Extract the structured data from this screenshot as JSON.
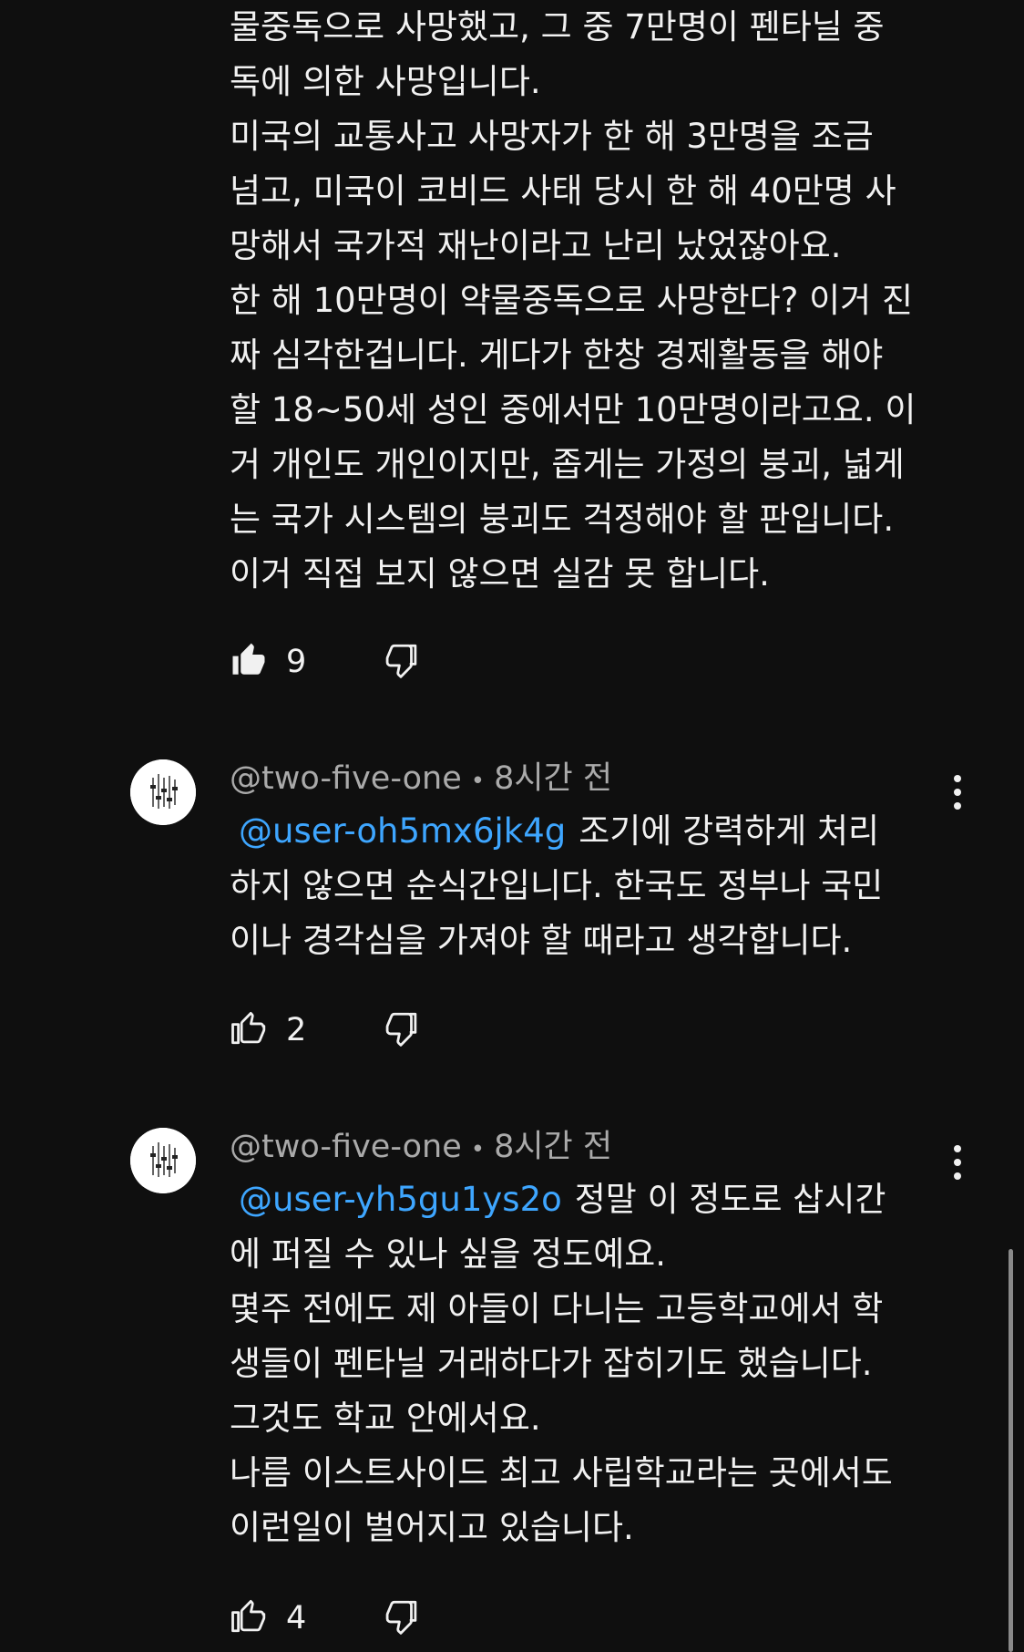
{
  "top_comment": {
    "lines": [
      "물중독으로 사망했고, 그 중 7만명이 펜타닐 중",
      "독에 의한 사망입니다.",
      "미국의 교통사고 사망자가 한 해 3만명을 조금",
      "넘고, 미국이 코비드 사태 당시 한 해 40만명 사",
      "망해서 국가적 재난이라고 난리 났었잖아요.",
      "한 해 10만명이 약물중독으로 사망한다? 이거 진",
      "짜 심각한겁니다. 게다가 한창 경제활동을 해야",
      "할 18~50세 성인 중에서만 10만명이라고요. 이",
      "거 개인도 개인이지만, 좁게는 가정의 붕괴, 넓게",
      "는 국가 시스템의 붕괴도 걱정해야 할 판입니다.",
      "이거 직접 보지 않으면 실감 못 합니다."
    ],
    "like_count": "9",
    "liked": true
  },
  "replies": [
    {
      "author": "@two-five-one",
      "separator": "•",
      "time": "8시간 전",
      "mention": "@user-oh5mx6jk4g",
      "first_line_rest": "조기에 강력하게 처리",
      "lines": [
        "하지 않으면 순식간입니다. 한국도 정부나 국민",
        "이나 경각심을 가져야 할 때라고 생각합니다."
      ],
      "like_count": "2",
      "liked": false
    },
    {
      "author": "@two-five-one",
      "separator": "•",
      "time": "8시간 전",
      "mention": "@user-yh5gu1ys2o",
      "first_line_rest": "정말 이 정도로 삽시간",
      "lines": [
        "에 퍼질 수 있나 싶을 정도예요.",
        "몇주 전에도 제 아들이 다니는 고등학교에서 학",
        "생들이 펜타닐 거래하다가 잡히기도 했습니다.",
        "그것도 학교 안에서요.",
        "나름 이스트사이드 최고 사립학교라는 곳에서도",
        "이런일이 벌어지고 있습니다."
      ],
      "like_count": "4",
      "liked": false
    }
  ],
  "colors": {
    "background": "#0f0f0f",
    "text": "#f1f1f1",
    "secondary_text": "#aaaaaa",
    "mention": "#3ea6ff"
  },
  "icons": {
    "like": "thumbs-up-icon",
    "dislike": "thumbs-down-icon",
    "menu": "more-vertical-icon",
    "avatar": "equalizer-avatar"
  }
}
